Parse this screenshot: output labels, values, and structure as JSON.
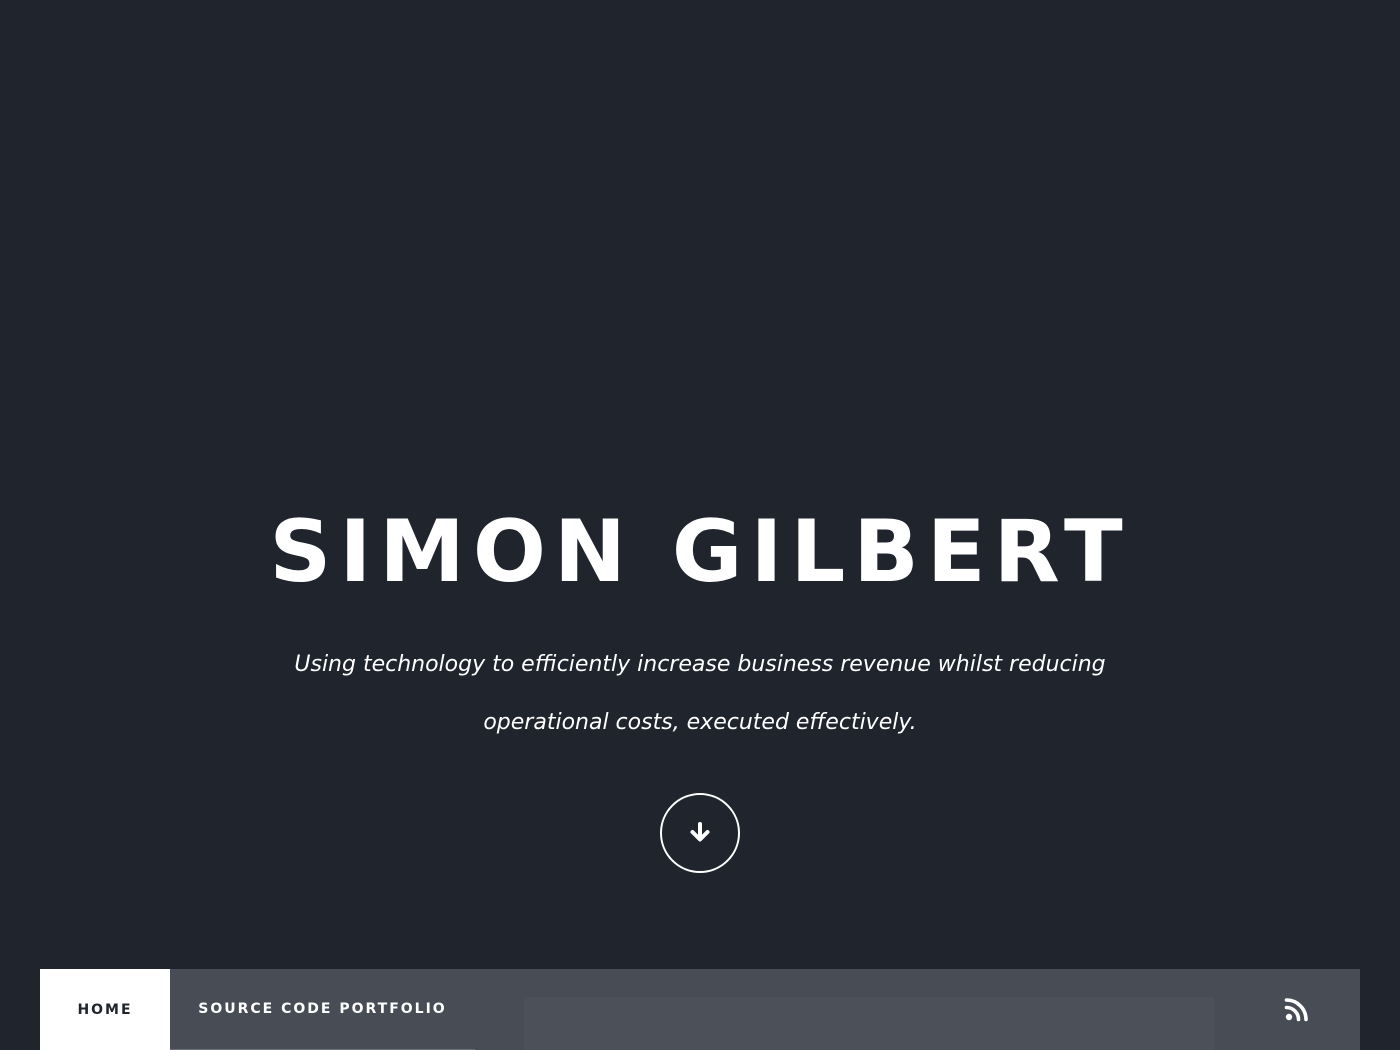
{
  "hero": {
    "title": "SIMON GILBERT",
    "tagline": "Using technology to efficiently increase business revenue whilst reducing operational costs, executed effectively.",
    "scroll_icon": "arrow-down-icon"
  },
  "nav": {
    "items": [
      {
        "label": "HOME",
        "active": true
      },
      {
        "label": "SOURCE CODE PORTFOLIO",
        "active": false
      }
    ],
    "rss_icon": "rss-icon"
  },
  "colors": {
    "background": "#1f242d",
    "nav_background": "#474c55",
    "active_tab": "#ffffff",
    "text": "#ffffff"
  }
}
